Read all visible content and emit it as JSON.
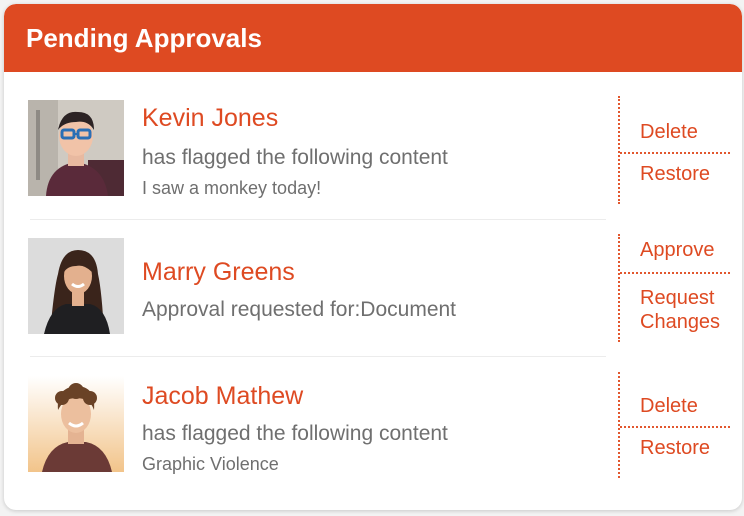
{
  "header": {
    "title": "Pending Approvals"
  },
  "colors": {
    "accent": "#de4a22",
    "text_muted": "#6f6f6f",
    "background": "#ffffff"
  },
  "items": [
    {
      "name": "Kevin Jones",
      "description": "has flagged the following content",
      "detail": "I saw a monkey today!",
      "actions": [
        "Delete",
        "Restore"
      ]
    },
    {
      "name": "Marry Greens",
      "description": "Approval requested for:Document",
      "detail": "",
      "actions": [
        "Approve",
        "Request Changes"
      ]
    },
    {
      "name": "Jacob Mathew",
      "description": "has flagged the following content",
      "detail": "Graphic Violence",
      "actions": [
        "Delete",
        "Restore"
      ]
    }
  ]
}
